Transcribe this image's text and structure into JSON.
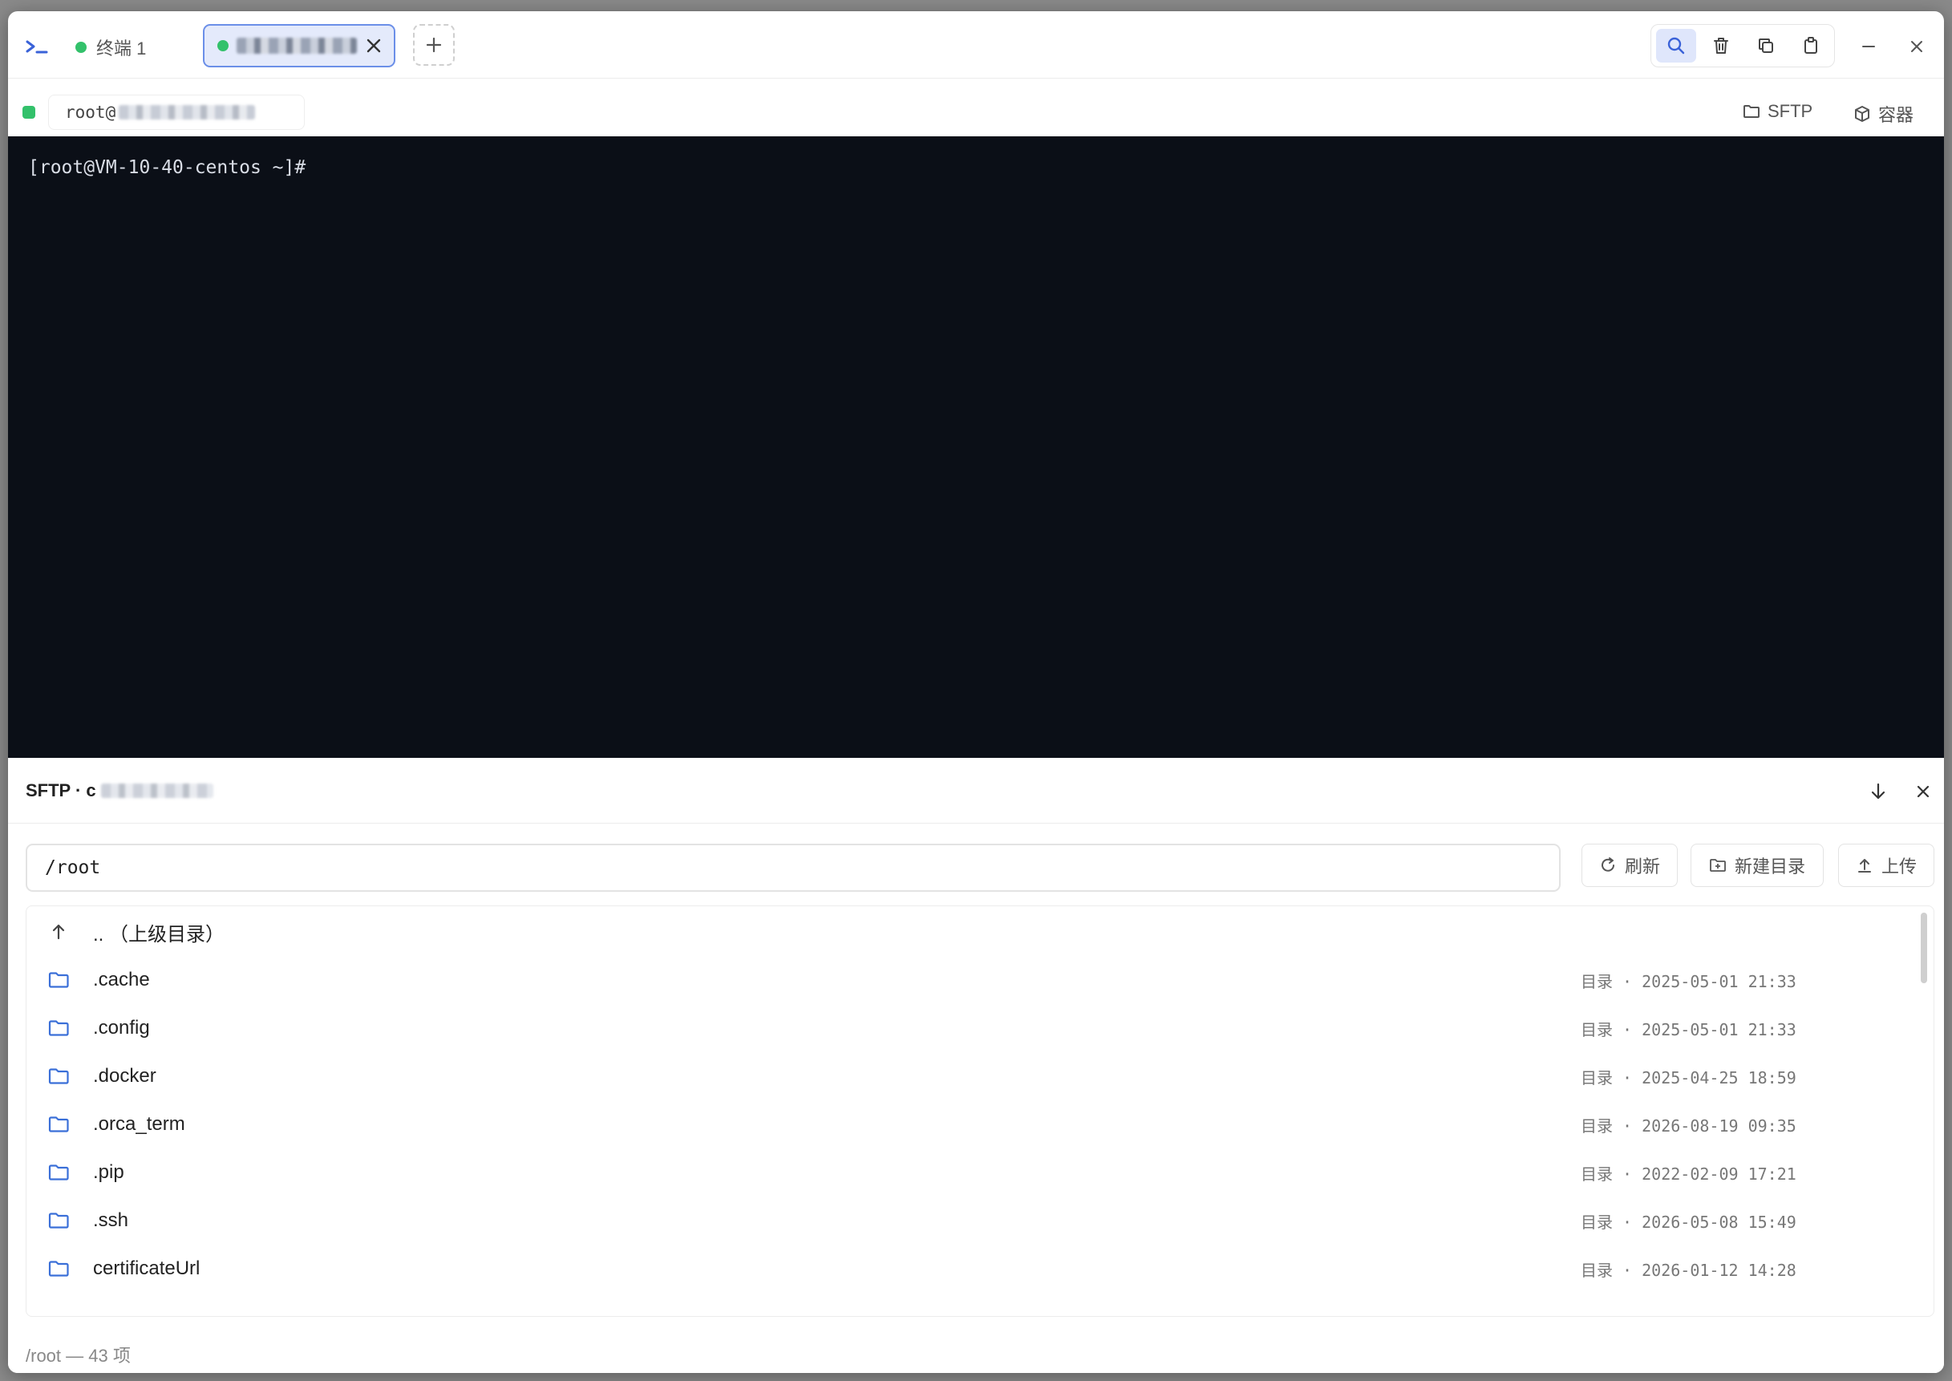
{
  "titlebar": {
    "tabs": [
      {
        "label": "终端 1"
      },
      {
        "label": ""
      }
    ],
    "new_tab_symbol": "+"
  },
  "address": {
    "user_prefix": "root@",
    "sftp_label": "SFTP",
    "container_label": "容器"
  },
  "terminal": {
    "prompt": "[root@VM-10-40-centos ~]#"
  },
  "sftp": {
    "title": "SFTP · c",
    "path": "/root",
    "refresh_label": "刷新",
    "mkdir_label": "新建目录",
    "upload_label": "上传",
    "parent_label": ".. （上级目录）",
    "files": [
      {
        "name": ".cache",
        "meta": "目录 · 2025-05-01 21:33"
      },
      {
        "name": ".config",
        "meta": "目录 · 2025-05-01 21:33"
      },
      {
        "name": ".docker",
        "meta": "目录 · 2025-04-25 18:59"
      },
      {
        "name": ".orca_term",
        "meta": "目录 · 2026-08-19 09:35"
      },
      {
        "name": ".pip",
        "meta": "目录 · 2022-02-09 17:21"
      },
      {
        "name": ".ssh",
        "meta": "目录 · 2026-05-08 15:49"
      },
      {
        "name": "certificateUrl",
        "meta": "目录 · 2026-01-12 14:28"
      }
    ],
    "status": "/root — 43 项"
  },
  "colors": {
    "accent": "#3a62d8",
    "status_green": "#33c16b",
    "terminal_bg": "#0b0f17"
  }
}
